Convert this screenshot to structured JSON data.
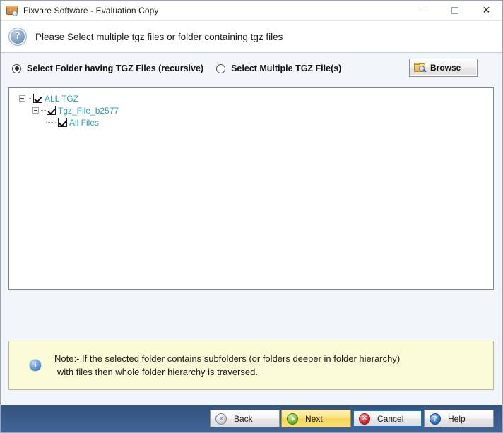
{
  "window": {
    "title": "Fixvare Software - Evaluation Copy",
    "app_icon": "archive-box-icon",
    "controls": {
      "minimize": "minimize-icon",
      "maximize": "maximize-icon",
      "close": "close-icon"
    }
  },
  "header": {
    "icon": "question-mark-icon",
    "instruction": "Please Select multiple tgz files or folder containing tgz files"
  },
  "options": {
    "radio_folder": {
      "label": "Select Folder having TGZ Files (recursive)",
      "selected": true
    },
    "radio_files": {
      "label": "Select Multiple TGZ File(s)",
      "selected": false
    },
    "browse": {
      "label": "Browse",
      "icon": "folder-search-icon"
    }
  },
  "tree": {
    "nodes": [
      {
        "label": "ALL TGZ",
        "level": 1,
        "checked": true,
        "expanded": true
      },
      {
        "label": "Tgz_File_b2577",
        "level": 2,
        "checked": true,
        "expanded": true
      },
      {
        "label": "All Files",
        "level": 3,
        "checked": true,
        "expanded": false
      }
    ]
  },
  "note": {
    "icon": "info-icon",
    "line1": "Note:- If the selected folder contains subfolders (or folders deeper in folder hierarchy)",
    "line2": "with files then whole folder hierarchy is traversed."
  },
  "footer": {
    "buttons": [
      {
        "label": "Back",
        "icon": "rewind-icon"
      },
      {
        "label": "Next",
        "icon": "play-icon"
      },
      {
        "label": "Cancel",
        "icon": "cancel-x-icon"
      },
      {
        "label": "Help",
        "icon": "question-mark-icon"
      }
    ]
  },
  "colors": {
    "tree_text": "#2aa3b0",
    "note_background": "#fbfbd8",
    "footer_gradient_top": "#35527c",
    "footer_gradient_bottom": "#3f6598",
    "next_button": "#f6d450",
    "cancel_focus_border": "#1a6fd4"
  }
}
